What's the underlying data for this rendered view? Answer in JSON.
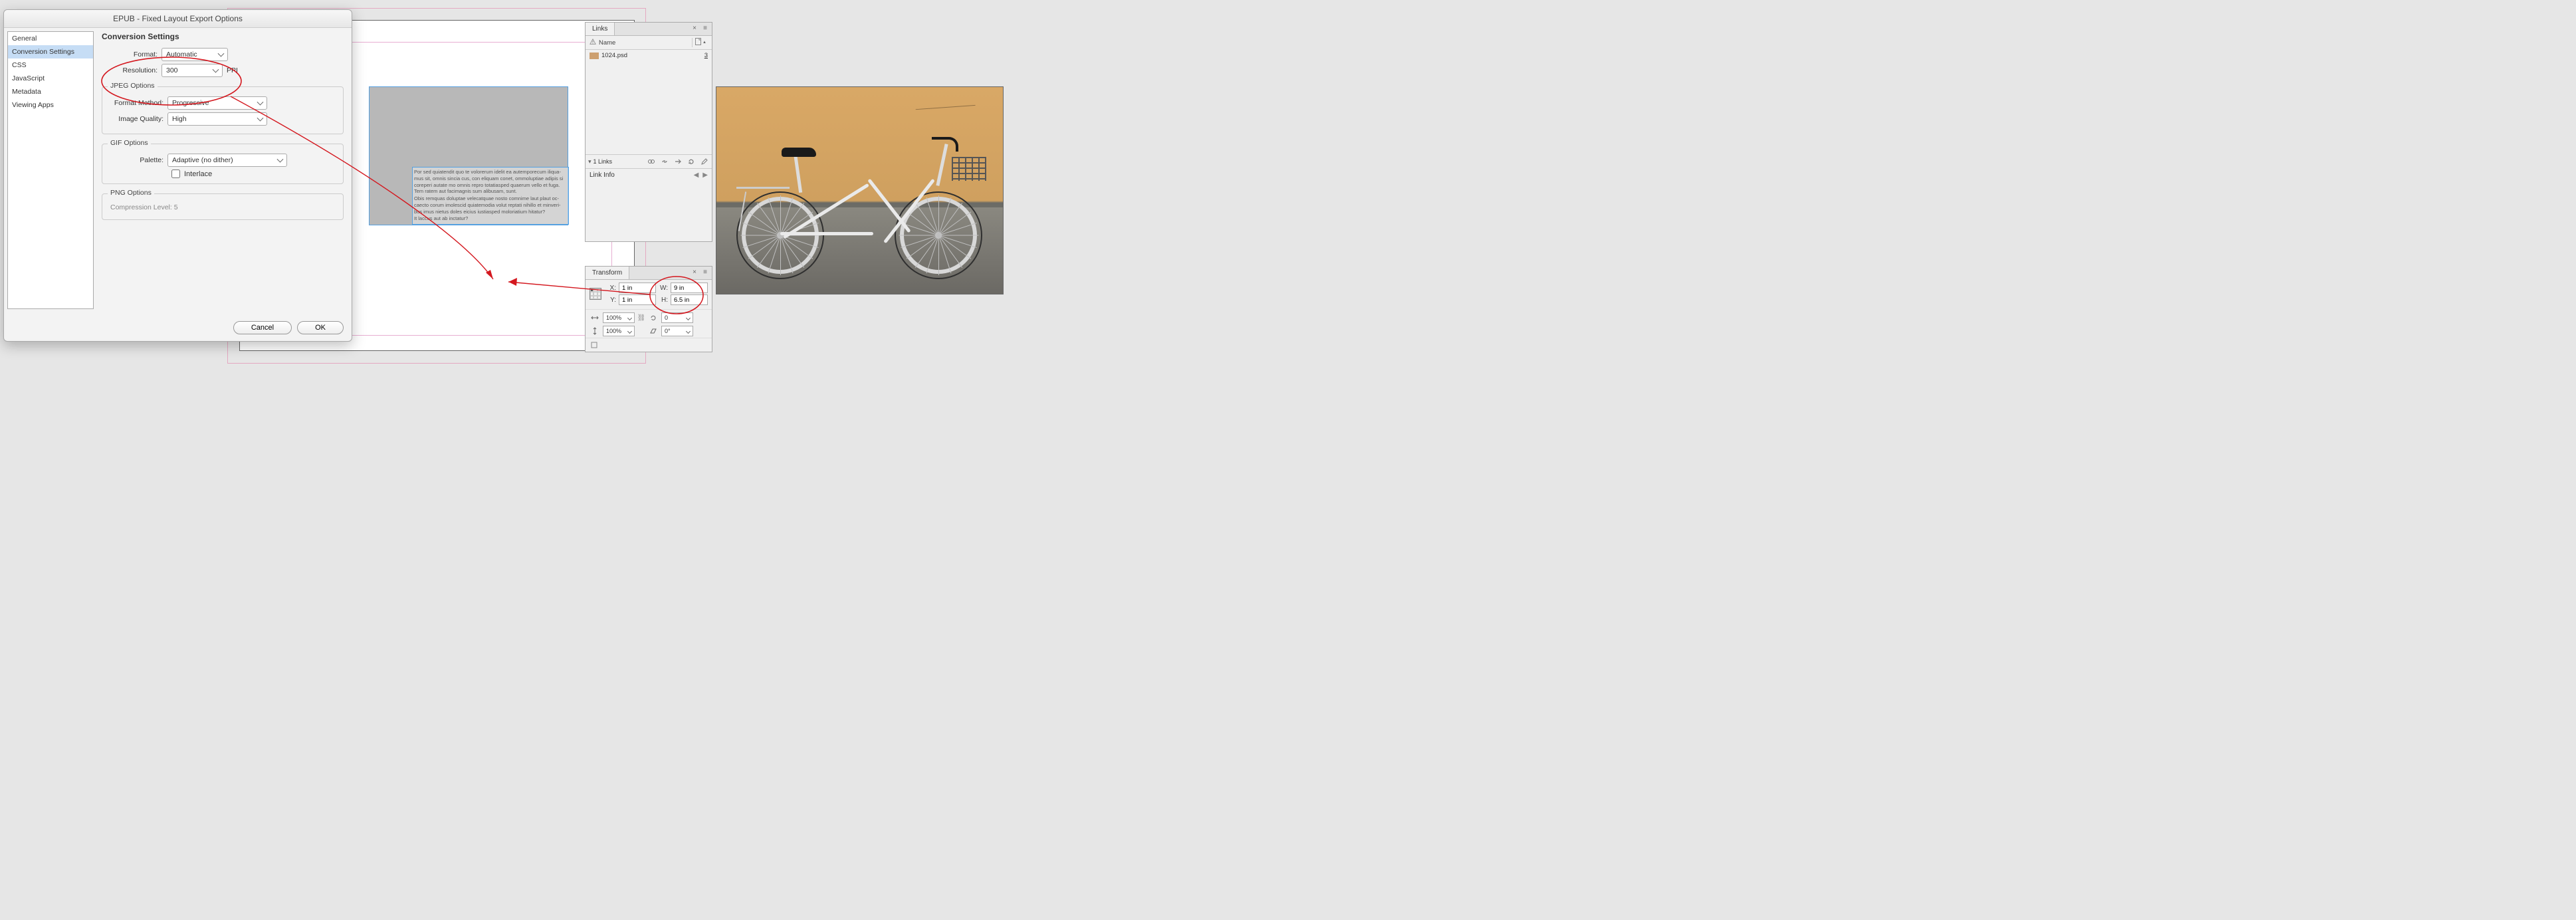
{
  "dialog": {
    "title": "EPUB - Fixed Layout Export Options",
    "sidebar": {
      "items": [
        {
          "label": "General"
        },
        {
          "label": "Conversion Settings"
        },
        {
          "label": "CSS"
        },
        {
          "label": "JavaScript"
        },
        {
          "label": "Metadata"
        },
        {
          "label": "Viewing Apps"
        }
      ],
      "active_index": 1
    },
    "heading": "Conversion Settings",
    "format": {
      "label": "Format:",
      "value": "Automatic"
    },
    "resolution": {
      "label": "Resolution:",
      "value": "300",
      "unit": "PPI"
    },
    "jpeg": {
      "legend": "JPEG Options",
      "format_method": {
        "label": "Format Method:",
        "value": "Progressive"
      },
      "image_quality": {
        "label": "Image Quality:",
        "value": "High"
      }
    },
    "gif": {
      "legend": "GIF Options",
      "palette": {
        "label": "Palette:",
        "value": "Adaptive (no dither)"
      },
      "interlace": {
        "label": "Interlace",
        "checked": false
      }
    },
    "png": {
      "legend": "PNG Options",
      "compression": {
        "label": "Compression Level:",
        "value": "5"
      }
    },
    "buttons": {
      "cancel": "Cancel",
      "ok": "OK"
    }
  },
  "text_frame": {
    "p1": "Por sed quiatendit quo te volorerum idelit ea autemporecum iliqua-mus sit, omnis sincia cus, con eliquam conet, ommoluptiae adipis si coreperi autate mo omnis repro totatiasped quaerum vello et fuga. Tem ratem aut facimagnis sum alibusam, sunt.",
    "p2": "Obis remquas doluptae velecatquae nosto comnime laut plaut oc-caecto corum imolescid quiatemodia volut reptati nihillo et minveri-bus imus nietus doles eicius iustiasped moloriatium hitatur?",
    "p3": "It laccus aut ab inctatur?"
  },
  "links_panel": {
    "tab": "Links",
    "columns": {
      "name": "Name"
    },
    "items": [
      {
        "name": "1024.psd",
        "page": "3"
      }
    ],
    "footer_count": "1 Links",
    "link_info_label": "Link Info"
  },
  "transform_panel": {
    "tab": "Transform",
    "X": {
      "label": "X:",
      "value": "1 in"
    },
    "Y": {
      "label": "Y:",
      "value": "1 in"
    },
    "W": {
      "label": "W:",
      "value": "9 in"
    },
    "H": {
      "label": "H:",
      "value": "6.5 in"
    },
    "scale_x": "100%",
    "scale_y": "100%",
    "rotate": "0",
    "shear": "0°"
  },
  "colors": {
    "annotation": "#d4181f",
    "select": "#55a0e0",
    "guide": "#e7aed2"
  }
}
